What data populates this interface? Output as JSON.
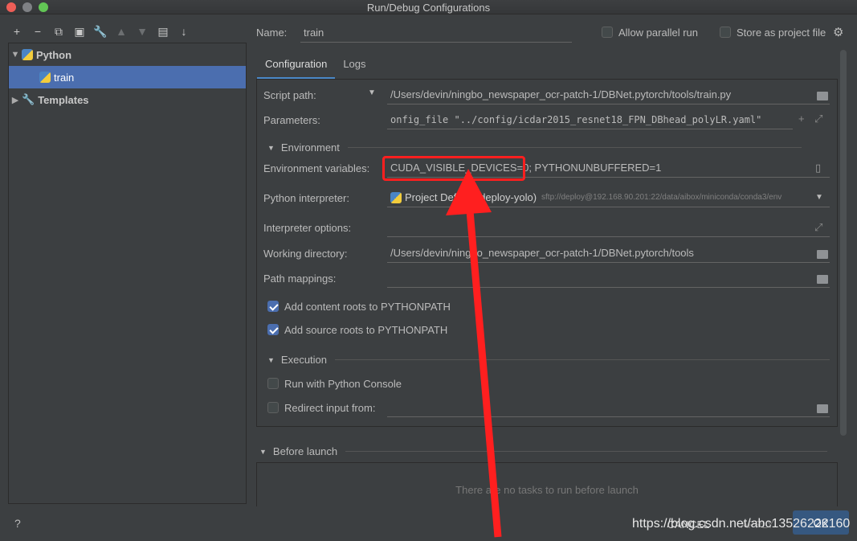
{
  "window": {
    "title": "Run/Debug Configurations"
  },
  "toolbar": {
    "icons": [
      "add-icon",
      "remove-icon",
      "copy-icon",
      "save-icon",
      "wrench-icon",
      "move-up-icon",
      "move-down-icon",
      "folder-icon",
      "sort-icon"
    ]
  },
  "tree": {
    "python_label": "Python",
    "train_label": "train",
    "templates_label": "Templates"
  },
  "header": {
    "name_label": "Name:",
    "name_value": "train",
    "allow_parallel_label": "Allow parallel run",
    "store_project_label": "Store as project file"
  },
  "tabs": [
    {
      "label": "Configuration",
      "active": true
    },
    {
      "label": "Logs",
      "active": false
    }
  ],
  "form": {
    "script_path_label": "Script path:",
    "script_path_value": "/Users/devin/ningbo_newspaper_ocr-patch-1/DBNet.pytorch/tools/train.py",
    "parameters_label": "Parameters:",
    "parameters_value": "onfig_file \"../config/icdar2015_resnet18_FPN_DBhead_polyLR.yaml\"",
    "environment_section": "Environment",
    "env_vars_label": "Environment variables:",
    "env_vars_value": "CUDA_VISIBLE_DEVICES=0; PYTHONUNBUFFERED=1",
    "interpreter_label": "Python interpreter:",
    "interpreter_value": "Project Default (deploy-yolo)",
    "interpreter_path": "sftp://deploy@192.168.90.201:22/data/aibox/miniconda/conda3/env",
    "interpreter_options_label": "Interpreter options:",
    "working_dir_label": "Working directory:",
    "working_dir_value": "/Users/devin/ningbo_newspaper_ocr-patch-1/DBNet.pytorch/tools",
    "path_mappings_label": "Path mappings:",
    "add_content_roots_label": "Add content roots to PYTHONPATH",
    "add_source_roots_label": "Add source roots to PYTHONPATH",
    "execution_section": "Execution",
    "run_console_label": "Run with Python Console",
    "redirect_input_label": "Redirect input from:",
    "before_launch_section": "Before launch",
    "no_tasks_text": "There are no tasks to run before launch"
  },
  "footer": {
    "help": "?",
    "cancel_label": "CANCEL",
    "apply_label": "APPLY",
    "ok_label": "OK",
    "watermark": "https://blog.csdn.net/abc13526222160"
  }
}
